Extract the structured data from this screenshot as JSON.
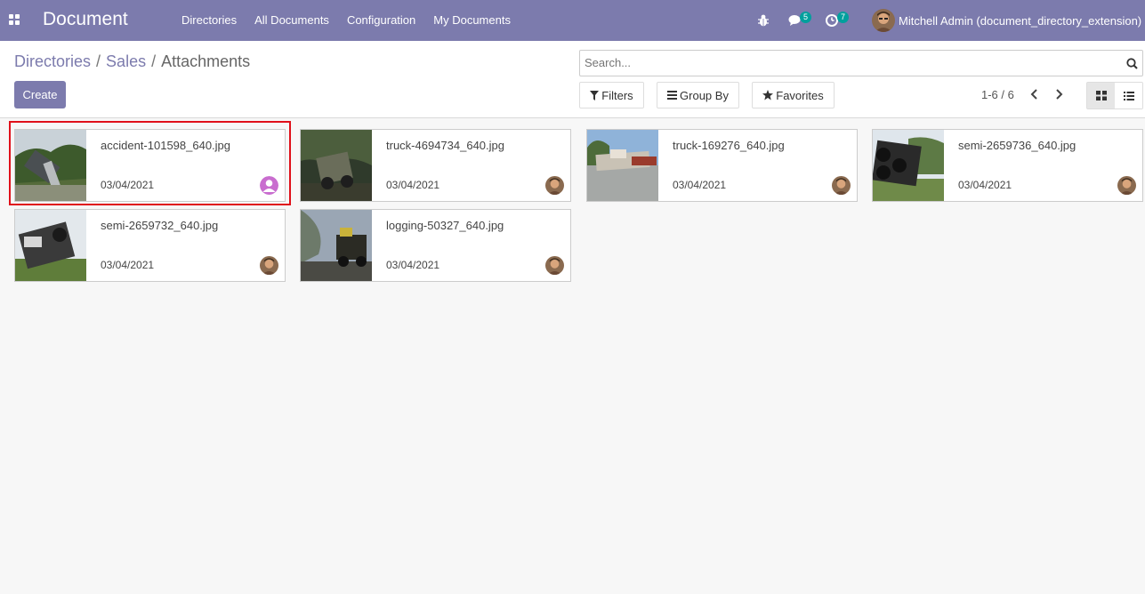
{
  "app": {
    "title": "Document"
  },
  "menu": [
    {
      "label": "Directories"
    },
    {
      "label": "All Documents"
    },
    {
      "label": "Configuration"
    },
    {
      "label": "My Documents"
    }
  ],
  "systray": {
    "messages_count": "5",
    "activities_count": "7",
    "user_name": "Mitchell Admin (document_directory_extension)"
  },
  "breadcrumb": {
    "items": [
      "Directories",
      "Sales"
    ],
    "current": "Attachments",
    "separator": "/"
  },
  "create_label": "Create",
  "search": {
    "placeholder": "Search..."
  },
  "options": {
    "filters": "Filters",
    "group_by": "Group By",
    "favorites": "Favorites"
  },
  "pager": {
    "value": "1-6 / 6"
  },
  "cards": [
    {
      "name": "accident-101598_640.jpg",
      "date": "03/04/2021",
      "owner": "placeholder"
    },
    {
      "name": "truck-4694734_640.jpg",
      "date": "03/04/2021",
      "owner": "admin"
    },
    {
      "name": "truck-169276_640.jpg",
      "date": "03/04/2021",
      "owner": "admin"
    },
    {
      "name": "semi-2659736_640.jpg",
      "date": "03/04/2021",
      "owner": "admin"
    },
    {
      "name": "semi-2659732_640.jpg",
      "date": "03/04/2021",
      "owner": "admin"
    },
    {
      "name": "logging-50327_640.jpg",
      "date": "03/04/2021",
      "owner": "admin"
    }
  ],
  "colors": {
    "brand": "#7c7bad",
    "badge": "#00a09d",
    "highlight": "#e0101a"
  }
}
